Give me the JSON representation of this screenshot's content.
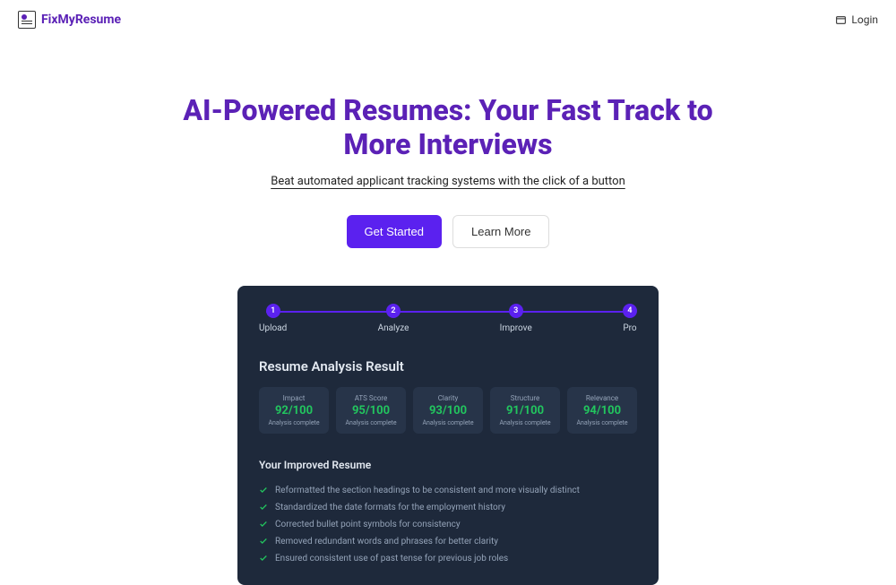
{
  "header": {
    "brand": "FixMyResume",
    "login": "Login"
  },
  "hero": {
    "title": "AI-Powered Resumes: Your Fast Track to More Interviews",
    "subtitle": "Beat automated applicant tracking systems with the click of a button",
    "cta_primary": "Get Started",
    "cta_secondary": "Learn More"
  },
  "steps": [
    {
      "num": "1",
      "label": "Upload"
    },
    {
      "num": "2",
      "label": "Analyze"
    },
    {
      "num": "3",
      "label": "Improve"
    },
    {
      "num": "4",
      "label": "Pro"
    }
  ],
  "analysis": {
    "title": "Resume Analysis Result",
    "scores": [
      {
        "label": "Impact",
        "value": "92/100",
        "status": "Analysis complete"
      },
      {
        "label": "ATS Score",
        "value": "95/100",
        "status": "Analysis complete"
      },
      {
        "label": "Clarity",
        "value": "93/100",
        "status": "Analysis complete"
      },
      {
        "label": "Structure",
        "value": "91/100",
        "status": "Analysis complete"
      },
      {
        "label": "Relevance",
        "value": "94/100",
        "status": "Analysis complete"
      }
    ]
  },
  "improved": {
    "title": "Your Improved Resume",
    "items": [
      "Reformatted the section headings to be consistent and more visually distinct",
      "Standardized the date formats for the employment history",
      "Corrected bullet point symbols for consistency",
      "Removed redundant words and phrases for better clarity",
      "Ensured consistent use of past tense for previous job roles"
    ]
  }
}
